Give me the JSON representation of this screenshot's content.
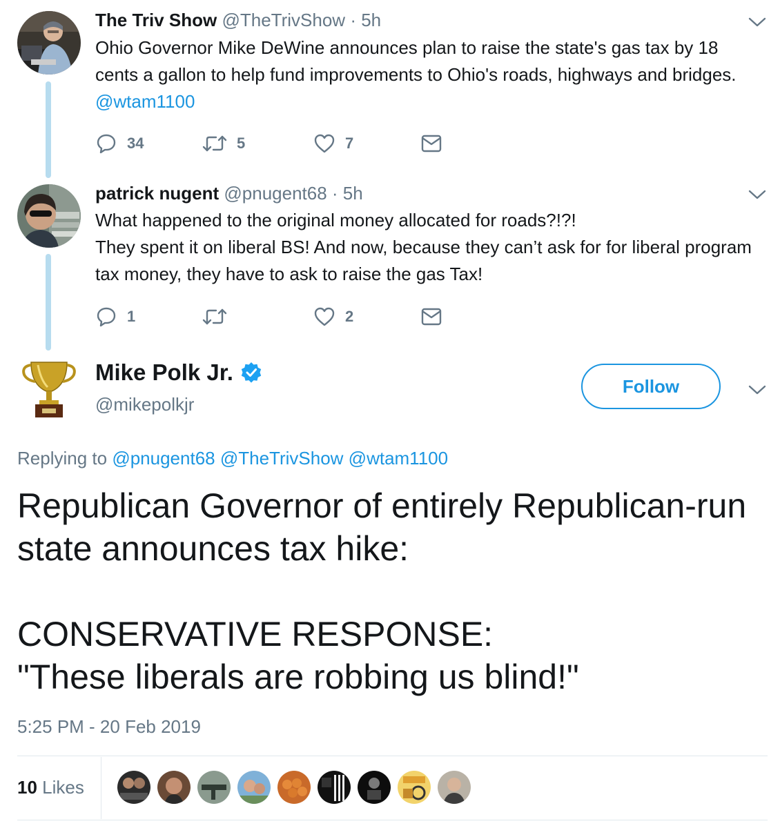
{
  "thread": [
    {
      "name": "The Triv Show",
      "handle": "@TheTrivShow",
      "time": "· 5h",
      "text_plain": "Ohio Governor Mike DeWine announces plan to raise the state's gas tax by 18 cents a gallon to help fund improvements to Ohio's roads, highways and bridges.",
      "text_link": "@wtam1100",
      "reply_count": "34",
      "retweet_count": "5",
      "like_count": "7"
    },
    {
      "name": "patrick nugent",
      "handle": "@pnugent68",
      "time": "· 5h",
      "line1": "What happened to the original money allocated for roads?!?!",
      "line2": "They spent it on liberal BS! And now, because they can’t ask for for liberal program tax money, they have to ask to raise the gas Tax!",
      "reply_count": "1",
      "retweet_count": "",
      "like_count": "2"
    }
  ],
  "main_tweet": {
    "name": "Mike Polk Jr.",
    "handle": "@mikepolkjr",
    "follow_label": "Follow",
    "replying_prefix": "Replying to",
    "replying_to": [
      "@pnugent68",
      "@TheTrivShow",
      "@wtam1100"
    ],
    "para1": "Republican Governor of entirely Republican-run state announces tax hike:",
    "para2_line1": "CONSERVATIVE RESPONSE:",
    "para2_line2": "\"These liberals are robbing us blind!\"",
    "timestamp": "5:25 PM - 20 Feb 2019",
    "likes_count": "10",
    "likes_label": "Likes"
  },
  "colors": {
    "accent": "#1b95e0",
    "secondary_text": "#657786",
    "primary_text": "#14171a",
    "thread_line": "#b7dcef",
    "divider": "#e1e8ed"
  },
  "icons": [
    "reply-icon",
    "retweet-icon",
    "like-icon",
    "direct-message-icon",
    "chevron-down-icon",
    "verified-badge-icon",
    "trophy-avatar-icon"
  ]
}
